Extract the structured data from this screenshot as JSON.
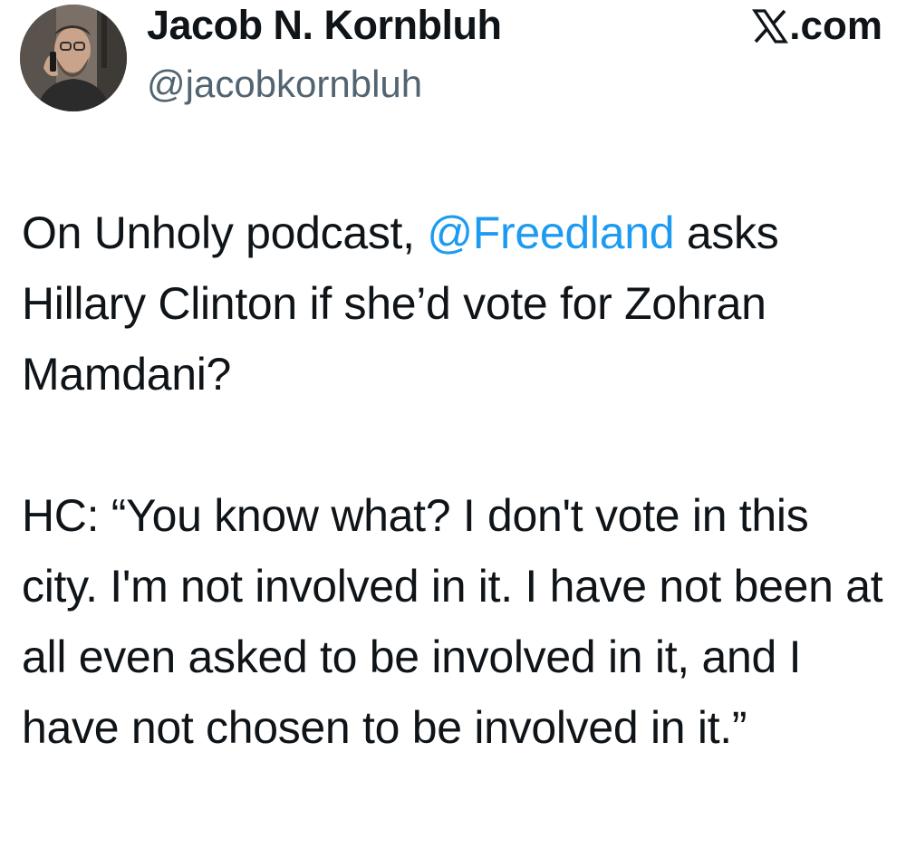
{
  "author": {
    "display_name": "Jacob N. Kornbluh",
    "handle": "@jacobkornbluh",
    "avatar_icon": "profile-photo"
  },
  "brand": {
    "icon": "x-logo-icon",
    "suffix": ".com"
  },
  "tweet": {
    "line1_before": "On Unholy podcast, ",
    "mention": "@Freedland",
    "line1_after": " asks Hillary Clinton if she’d vote for Zohran Mamdani?",
    "paragraph2": "HC: “You know what? I don't vote in this city. I'm not involved in it. I have not been at all even asked to be involved in it, and I have not chosen to be involved in it.”"
  },
  "colors": {
    "text": "#0f1419",
    "secondary": "#536471",
    "mention": "#1d9bf0"
  }
}
